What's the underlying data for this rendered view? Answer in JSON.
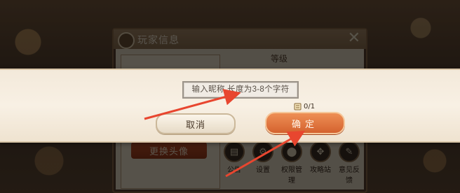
{
  "panel": {
    "title": "玩家信息",
    "level_label": "等级",
    "change_avatar_label": "更换头像",
    "close_glyph": "✕",
    "menu": [
      {
        "label": "公告",
        "icon": "notice-icon",
        "glyph": "▤"
      },
      {
        "label": "设置",
        "icon": "gear-icon",
        "glyph": "⚙"
      },
      {
        "label": "权限管理",
        "icon": "location-pin-icon",
        "glyph": "⬤"
      },
      {
        "label": "攻略站",
        "icon": "compass-icon",
        "glyph": "✥"
      },
      {
        "label": "意见反馈",
        "icon": "feedback-icon",
        "glyph": "✎"
      }
    ]
  },
  "dialog": {
    "placeholder": "输入昵称,长度为3-8个字符",
    "counter": "0/1",
    "cancel_label": "取消",
    "confirm_label": "确定"
  },
  "colors": {
    "confirm": "#e2743f",
    "arrow": "#e8462f",
    "banner": "#f5ede0"
  }
}
